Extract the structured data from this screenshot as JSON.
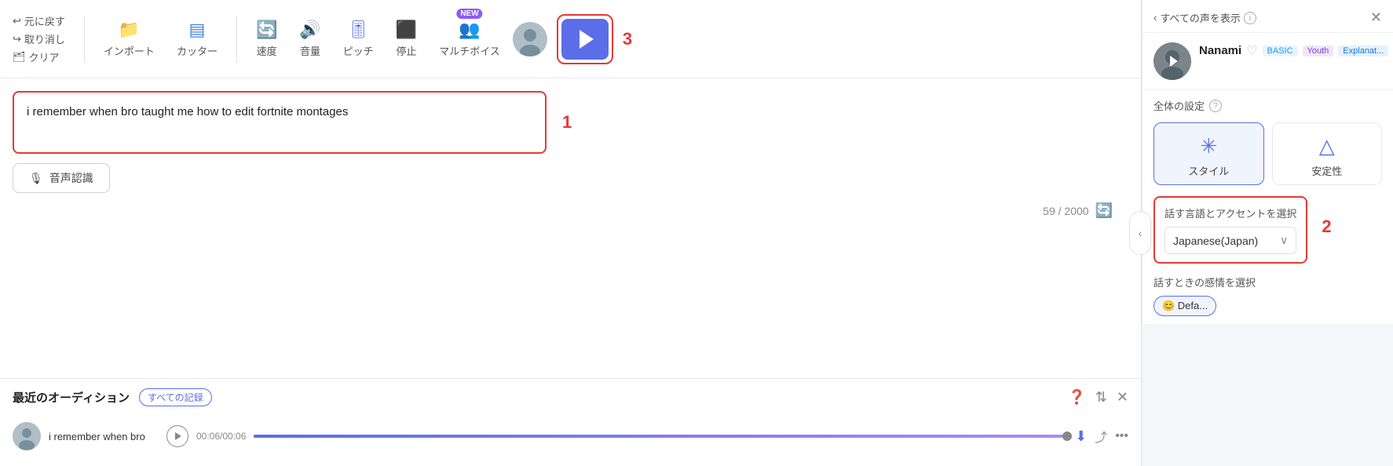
{
  "toolbar": {
    "back_label": "元に戻す",
    "redo_label": "取り消し",
    "clear_label": "クリア",
    "import_label": "インポート",
    "cutter_label": "カッター",
    "speed_label": "速度",
    "volume_label": "音量",
    "pitch_label": "ピッチ",
    "stop_label": "停止",
    "multivoice_label": "マルチボイス",
    "number3": "3"
  },
  "text_area": {
    "content": "i remember when bro taught me how to edit fortnite montages",
    "char_count": "59",
    "char_max": "2000",
    "number1": "1"
  },
  "voice_recognition": {
    "label": "音声認識"
  },
  "recent": {
    "title": "最近のオーディション",
    "all_records": "すべての記録",
    "audition_name": "i remember when bro",
    "time_current": "00:06",
    "time_total": "00:06"
  },
  "sidebar": {
    "show_all_voices": "すべての声を表示",
    "voice_name": "Nanami",
    "badge_basic": "BASIC",
    "badge_youth": "Youth",
    "badge_explanat": "Explanat...",
    "settings_title": "全体の設定",
    "style_label": "スタイル",
    "stability_label": "安定性",
    "language_section_title": "話す言語とアクセントを選択",
    "language_value": "Japanese(Japan)",
    "emotion_title": "話すときの感情を選択",
    "emotion_default": "😊 Defa...",
    "number2": "2"
  }
}
